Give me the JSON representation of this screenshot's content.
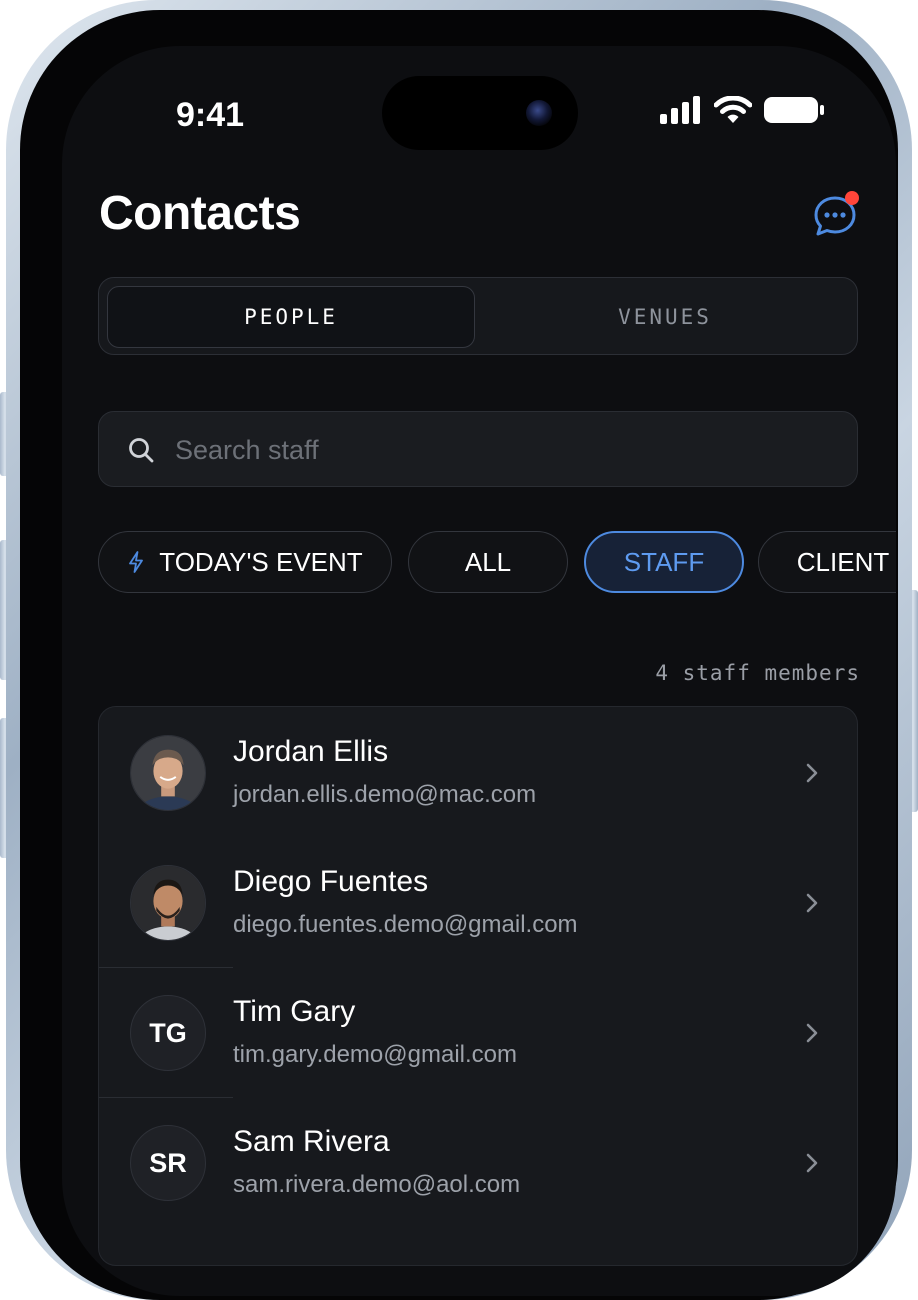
{
  "status_bar": {
    "time": "9:41"
  },
  "header": {
    "title": "Contacts"
  },
  "segments": {
    "people": "PEOPLE",
    "venues": "VENUES"
  },
  "search": {
    "placeholder": "Search staff",
    "value": ""
  },
  "filters": {
    "todays_event": "TODAY'S EVENT",
    "all": "ALL",
    "staff": "STAFF",
    "client": "CLIENT",
    "selected": "STAFF"
  },
  "count_label": "4 staff members",
  "contacts": [
    {
      "name": "Jordan Ellis",
      "email": "jordan.ellis.demo@mac.com",
      "avatar": "photo"
    },
    {
      "name": "Diego Fuentes",
      "email": "diego.fuentes.demo@gmail.com",
      "avatar": "photo"
    },
    {
      "name": "Tim Gary",
      "email": "tim.gary.demo@gmail.com",
      "initials": "TG"
    },
    {
      "name": "Sam Rivera",
      "email": "sam.rivera.demo@aol.com",
      "initials": "SR"
    }
  ],
  "icons": {
    "messages": "chat-bubble-icon",
    "search": "search-icon",
    "event": "lightning-icon",
    "row": "chevron-right-icon"
  },
  "colors": {
    "accent": "#5e9bf0",
    "notification": "#ff453a",
    "background": "#0d0e11"
  }
}
